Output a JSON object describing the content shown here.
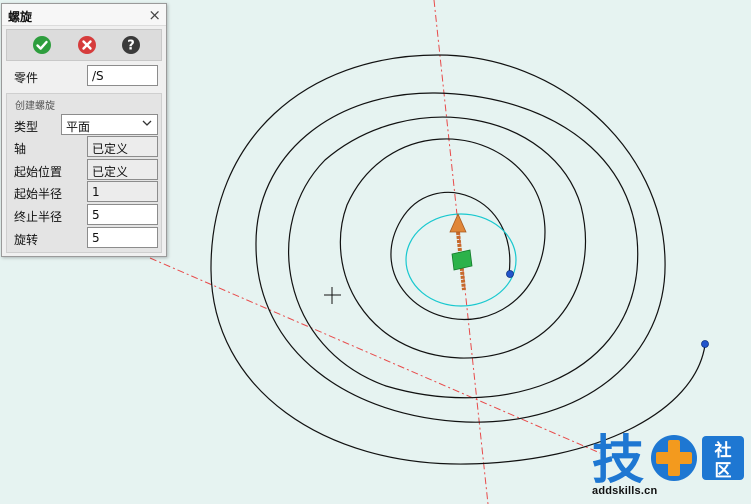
{
  "panel": {
    "title": "螺旋",
    "close_symbol": "×",
    "buttons": [
      {
        "icon": "confirm-check-icon",
        "color": "#2e9e3e"
      },
      {
        "icon": "cancel-x-icon",
        "color": "#d63c3c"
      },
      {
        "icon": "help-question-icon",
        "color": "#3a3a3a"
      }
    ],
    "part": {
      "label": "零件",
      "value": "/S"
    },
    "section_title": "创建螺旋",
    "fields": {
      "type": {
        "label": "类型",
        "value": "平面"
      },
      "axis": {
        "label": "轴",
        "value": "已定义"
      },
      "start_position": {
        "label": "起始位置",
        "value": "已定义"
      },
      "start_radius": {
        "label": "起始半径",
        "value": "1"
      },
      "end_radius": {
        "label": "终止半径",
        "value": "5"
      },
      "rotation": {
        "label": "旋转",
        "value": "5"
      }
    }
  },
  "viewport": {
    "background": "#e6f3f1",
    "spiral_color": "#111111",
    "preview_color": "#19c8cf",
    "axis_line_color": "#e84a4a",
    "handle_colors": {
      "arrow": "#e0873a",
      "square": "#2cb24a",
      "endpoint": "#2255cc"
    }
  },
  "watermark": {
    "chars": [
      "技",
      "社",
      "区"
    ],
    "url": "addskills.cn",
    "blue": "#1e77d2",
    "orange": "#f39a1e"
  }
}
